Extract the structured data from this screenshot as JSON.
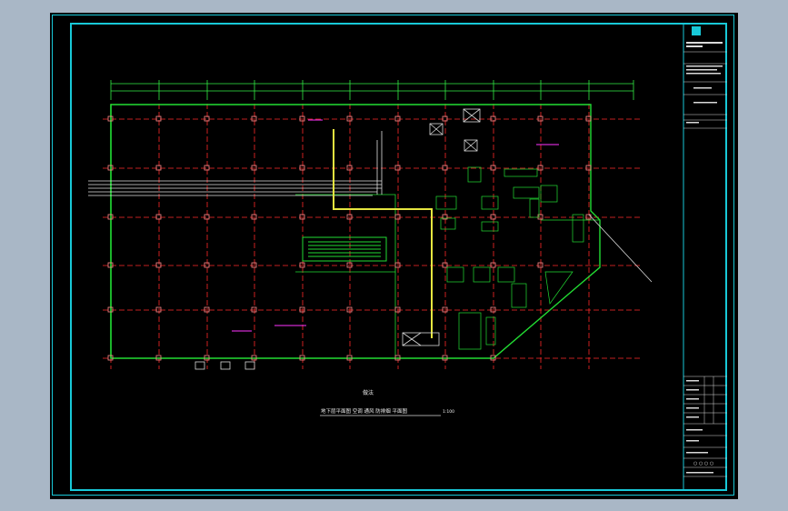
{
  "drawing": {
    "plan_caption": "地下层平面图 空调 通风 防排烟 平面图",
    "plan_scale": "1:100",
    "detail_label": "做法"
  },
  "title_block": {
    "bottom_code": "○ ○ ○ ○"
  },
  "colors": {
    "background": "#a9b7c6",
    "sheet": "#000000",
    "frame": "#18c9d8",
    "axis_grid": "#ff2a2a",
    "dimension": "#33ee44",
    "duct": "#e6e640",
    "wall": "#22dd33",
    "equipment": "#d9d9d9",
    "annotation": "#ff33ff"
  }
}
